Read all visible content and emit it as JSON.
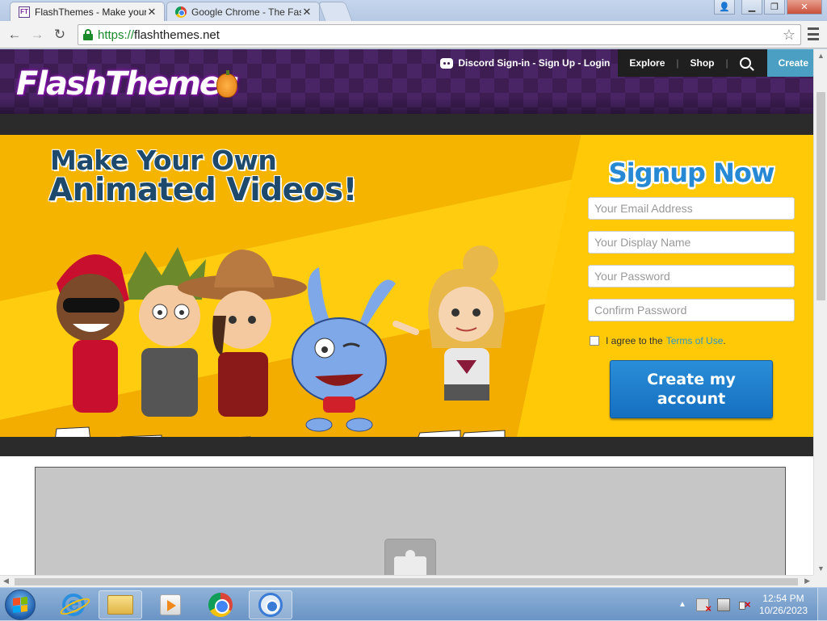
{
  "browser": {
    "tabs": [
      {
        "title": "FlashThemes - Make your",
        "active": true,
        "favicon": "flashthemes-favicon"
      },
      {
        "title": "Google Chrome - The Fas",
        "active": false,
        "favicon": "chrome-favicon"
      }
    ],
    "url": {
      "scheme": "https://",
      "host": "flashthemes.net"
    }
  },
  "site": {
    "logo_text": "FlashThemes",
    "nav": {
      "discord": "Discord Sign-in - Sign Up - Login",
      "explore": "Explore",
      "separator": "|",
      "shop": "Shop",
      "create": "Create"
    },
    "hero": {
      "headline_line1": "Make Your Own",
      "headline_line2": "Animated Videos!"
    },
    "signup": {
      "title": "Signup Now",
      "email_placeholder": "Your Email Address",
      "display_name_placeholder": "Your Display Name",
      "password_placeholder": "Your Password",
      "confirm_password_placeholder": "Confirm Password",
      "agree_prefix": "I agree to the",
      "terms_link": "Terms of Use",
      "agree_suffix": ".",
      "submit_line1": "Create my",
      "submit_line2": "account"
    }
  },
  "taskbar": {
    "clock_time": "12:54 PM",
    "clock_date": "10/26/2023"
  },
  "colors": {
    "header_purple": "#3d1d52",
    "hero_yellow": "#f4b400",
    "signup_blue": "#2789d4",
    "cta_blue": "#1a7fcc",
    "create_teal": "#4a9fc2"
  }
}
